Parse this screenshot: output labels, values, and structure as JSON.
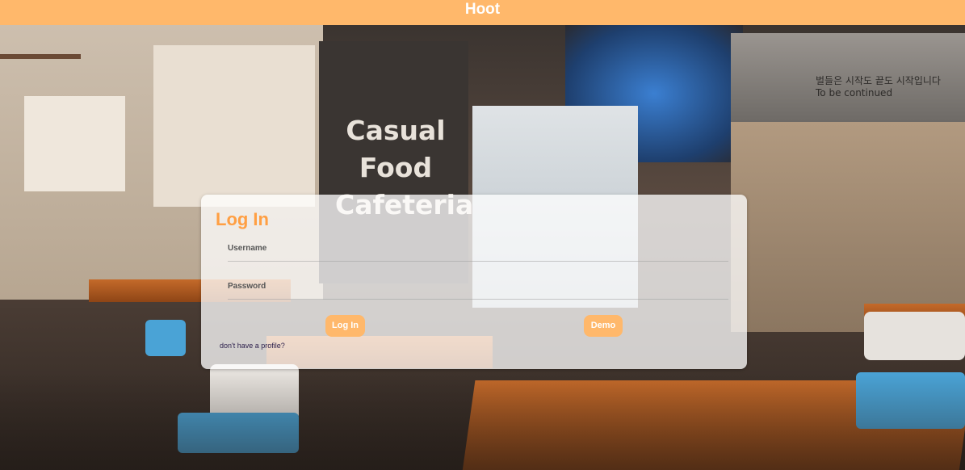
{
  "app": {
    "title": "Hoot"
  },
  "background": {
    "sign_lines": [
      "Casual",
      "Food",
      "Cafeteria"
    ],
    "hood_text": "벌들은 시작도 끝도 시작입니다",
    "hood_subtext": "To be continued"
  },
  "login": {
    "title": "Log In",
    "username_label": "Username",
    "password_label": "Password",
    "username_value": "",
    "password_value": "",
    "login_button": "Log In",
    "demo_button": "Demo",
    "signup_link": "don't have a profile?"
  },
  "colors": {
    "accent": "#ffb86b",
    "title_orange": "#ff9f43",
    "link": "#2a1d4a"
  }
}
